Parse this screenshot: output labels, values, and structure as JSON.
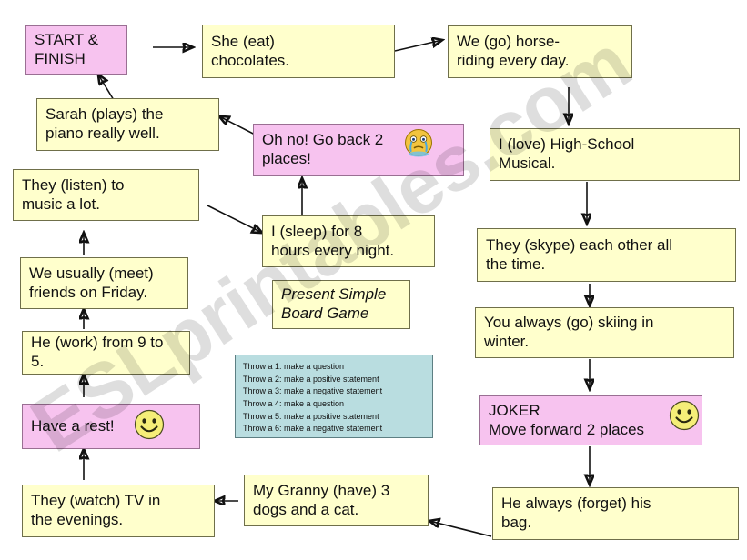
{
  "document": {
    "title": "Present Simple Board Game",
    "watermark": "ESLprintables.com"
  },
  "colors": {
    "yellow_cell": "#ffffcc",
    "pink_cell": "#f7c3ef",
    "rules_cell": "#b9dde0",
    "border": "#6f6f4a",
    "arrow": "#111111",
    "smiley": "#f5ee78"
  },
  "board": {
    "title_cell": "Present Simple\nBoard Game",
    "title_line1": "Present Simple",
    "title_line2": "Board Game",
    "cells": [
      {
        "id": "start",
        "text": "START & FINISH",
        "type": "pink",
        "icon": null
      },
      {
        "id": "eat",
        "text": "She (eat) chocolates.",
        "type": "yellow",
        "icon": null
      },
      {
        "id": "horse",
        "text": "We (go) horse-riding every day.",
        "type": "yellow",
        "icon": null
      },
      {
        "id": "love",
        "text": "I (love) High-School Musical.",
        "type": "yellow",
        "icon": null
      },
      {
        "id": "skype",
        "text": "They (skype) each other all the time.",
        "type": "yellow",
        "icon": null
      },
      {
        "id": "ski",
        "text": "You always (go) skiing in winter.",
        "type": "yellow",
        "icon": null
      },
      {
        "id": "joker",
        "text": "JOKER\nMove forward 2 places",
        "type": "pink",
        "icon": "smiley-icon"
      },
      {
        "id": "forget",
        "text": "He always (forget) his bag.",
        "type": "yellow",
        "icon": null
      },
      {
        "id": "granny",
        "text": "My Granny (have) 3 dogs and a cat.",
        "type": "yellow",
        "icon": null
      },
      {
        "id": "watch",
        "text": "They (watch) TV in the evenings.",
        "type": "yellow",
        "icon": null
      },
      {
        "id": "rest",
        "text": "Have a rest!",
        "type": "pink",
        "icon": "smiley-icon"
      },
      {
        "id": "work",
        "text": "He (work) from 9 to 5.",
        "type": "yellow",
        "icon": null
      },
      {
        "id": "meet",
        "text": "We usually (meet) friends on Friday.",
        "type": "yellow",
        "icon": null
      },
      {
        "id": "listen",
        "text": "They (listen) to music a lot.",
        "type": "yellow",
        "icon": null
      },
      {
        "id": "sleep",
        "text": "I (sleep) for 8 hours every night.",
        "type": "yellow",
        "icon": null
      },
      {
        "id": "goback",
        "text": "Oh no! Go back 2 places!",
        "type": "pink",
        "icon": "crying-icon"
      },
      {
        "id": "piano",
        "text": "Sarah (plays) the piano really well.",
        "type": "yellow",
        "icon": null
      }
    ],
    "cell_lines": {
      "start": [
        "START &",
        "FINISH"
      ],
      "eat": [
        "She (eat)",
        "chocolates."
      ],
      "horse": [
        "We (go) horse-",
        "riding every day."
      ],
      "love": [
        "I (love) High-School",
        "Musical."
      ],
      "skype": [
        "They (skype) each other all",
        "the time."
      ],
      "ski": [
        "You always (go) skiing in",
        "winter."
      ],
      "joker": [
        "JOKER",
        "Move forward 2 places"
      ],
      "forget": [
        "He always (forget) his",
        "bag."
      ],
      "granny": [
        "My Granny (have) 3",
        "dogs and a cat."
      ],
      "watch": [
        "They (watch) TV in",
        "the evenings."
      ],
      "rest": [
        "Have a rest!"
      ],
      "work": [
        "He (work) from 9 to",
        "5."
      ],
      "meet": [
        "We usually (meet)",
        "friends on Friday."
      ],
      "listen": [
        "They (listen) to",
        "music a lot."
      ],
      "sleep": [
        "I (sleep) for 8",
        "hours every night."
      ],
      "goback": [
        "Oh no! Go back 2",
        "places!"
      ],
      "piano": [
        "Sarah (plays) the",
        "piano really well."
      ]
    },
    "rules": {
      "lines": [
        "Throw a 1: make a question",
        "Throw a 2: make a positive statement",
        "Throw a 3: make a negative statement",
        "Throw a 4: make a question",
        "Throw a 5: make a positive statement",
        "Throw a 6: make a negative statement"
      ]
    }
  }
}
